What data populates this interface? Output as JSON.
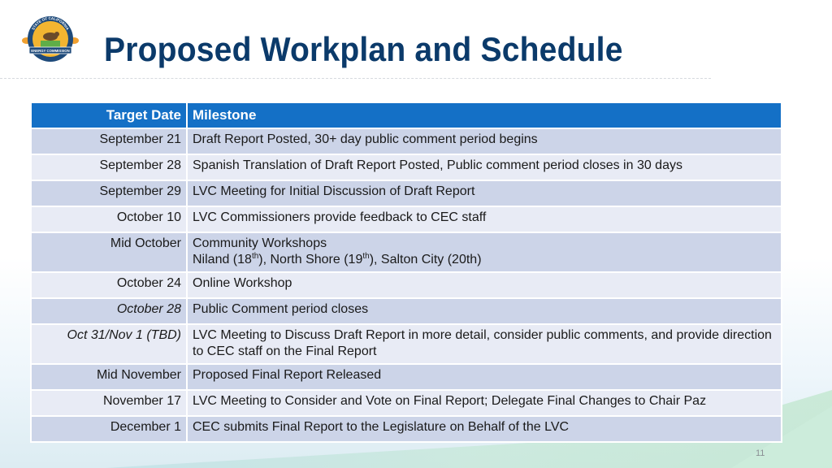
{
  "slide": {
    "title": "Proposed Workplan and Schedule",
    "page_number": "11",
    "logo": {
      "icon": "state-seal-logo",
      "top_text": "STATE OF CALIFORNIA",
      "banner_text": "ENERGY COMMISSION"
    }
  },
  "table": {
    "headers": {
      "date": "Target Date",
      "milestone": "Milestone"
    },
    "rows": [
      {
        "date": "September 21",
        "italic": false,
        "milestone": "Draft Report Posted, 30+ day public comment period begins"
      },
      {
        "date": "September 28",
        "italic": false,
        "milestone": "Spanish Translation of Draft Report Posted, Public comment period closes in 30 days"
      },
      {
        "date": "September 29",
        "italic": false,
        "milestone": "LVC Meeting for Initial Discussion of Draft Report"
      },
      {
        "date": "October 10",
        "italic": false,
        "milestone": "LVC Commissioners provide feedback to CEC staff"
      },
      {
        "date": "Mid October",
        "italic": false,
        "milestone": "Community Workshops",
        "locations": {
          "a_prefix": "Niland (18",
          "a_sup": "th",
          "a_suffix": "), ",
          "b_prefix": "North Shore (19",
          "b_sup": "th",
          "b_suffix": "), ",
          "c": "Salton City (20th)"
        }
      },
      {
        "date": "October 24",
        "italic": false,
        "milestone": "Online Workshop"
      },
      {
        "date": "October 28",
        "italic": true,
        "milestone": "Public Comment period closes"
      },
      {
        "date": "Oct 31/Nov 1 (TBD)",
        "italic": true,
        "milestone": "LVC Meeting to Discuss Draft Report in more detail, consider public comments, and provide direction to CEC staff on the Final Report"
      },
      {
        "date": "Mid November",
        "italic": false,
        "milestone": "Proposed Final Report Released"
      },
      {
        "date": "November 17",
        "italic": false,
        "milestone": "LVC Meeting to Consider and Vote on Final Report; Delegate Final Changes to Chair Paz"
      },
      {
        "date": "December 1",
        "italic": false,
        "milestone": "CEC submits Final Report to the Legislature on Behalf of the LVC"
      }
    ]
  },
  "colors": {
    "title": "#0b3a6a",
    "header_bg": "#1470c6",
    "row_dark": "#ccd4e8",
    "row_light": "#e8ebf5"
  }
}
